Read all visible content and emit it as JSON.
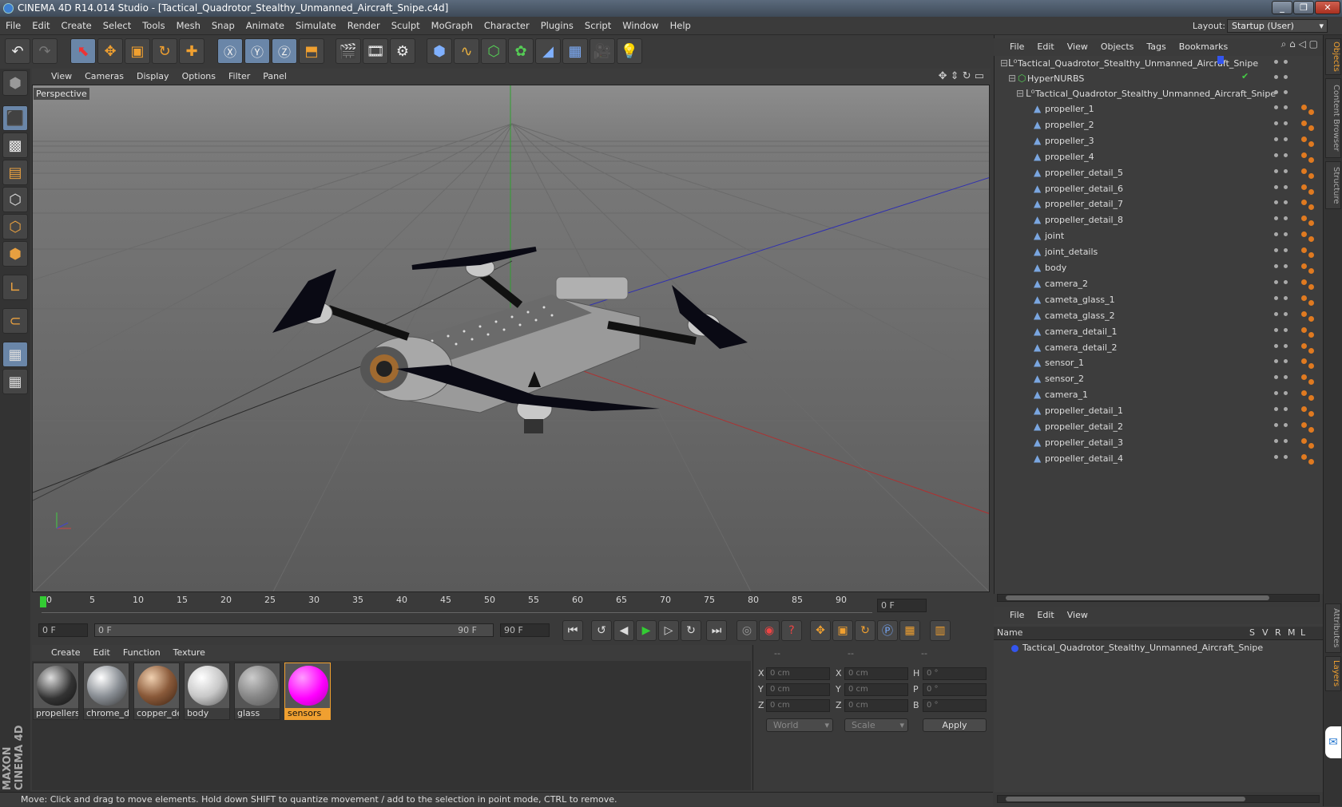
{
  "window": {
    "title": "CINEMA 4D R14.014 Studio - [Tactical_Quadrotor_Stealthy_Unmanned_Aircraft_Snipe.c4d]"
  },
  "menubar": {
    "items": [
      "File",
      "Edit",
      "Create",
      "Select",
      "Tools",
      "Mesh",
      "Snap",
      "Animate",
      "Simulate",
      "Render",
      "Sculpt",
      "MoGraph",
      "Character",
      "Plugins",
      "Script",
      "Window",
      "Help"
    ],
    "layout_label": "Layout:",
    "layout_value": "Startup (User)"
  },
  "viewport": {
    "menu": [
      "View",
      "Cameras",
      "Display",
      "Options",
      "Filter",
      "Panel"
    ],
    "label": "Perspective"
  },
  "timeline": {
    "ticks": [
      "0",
      "5",
      "10",
      "15",
      "20",
      "25",
      "30",
      "35",
      "40",
      "45",
      "50",
      "55",
      "60",
      "65",
      "70",
      "75",
      "80",
      "85",
      "90"
    ],
    "current_frame": "0 F",
    "start_field": "0 F",
    "range_start": "0 F",
    "range_end": "90 F",
    "end_field": "90 F"
  },
  "materials": {
    "menu": [
      "Create",
      "Edit",
      "Function",
      "Texture"
    ],
    "items": [
      {
        "name": "propellers",
        "color": "#3a3a3a"
      },
      {
        "name": "chrome_de",
        "color": "#9aa0a6"
      },
      {
        "name": "copper_det",
        "color": "#8a5a3a"
      },
      {
        "name": "body",
        "color": "#c8c8c8"
      },
      {
        "name": "glass",
        "color": "#888888"
      },
      {
        "name": "sensors",
        "color": "#ff00ff"
      }
    ]
  },
  "coordinates": {
    "headers": [
      "--",
      "--",
      "--"
    ],
    "rows": [
      {
        "axis": "X",
        "pos": "0 cm",
        "axis2": "X",
        "size": "0 cm",
        "axis3": "H",
        "rot": "0 °"
      },
      {
        "axis": "Y",
        "pos": "0 cm",
        "axis2": "Y",
        "size": "0 cm",
        "axis3": "P",
        "rot": "0 °"
      },
      {
        "axis": "Z",
        "pos": "0 cm",
        "axis2": "Z",
        "size": "0 cm",
        "axis3": "B",
        "rot": "0 °"
      }
    ],
    "world": "World",
    "scale": "Scale",
    "apply": "Apply"
  },
  "status": {
    "text": "Move: Click and drag to move elements. Hold down SHIFT to quantize movement / add to the selection in point mode, CTRL to remove."
  },
  "objects": {
    "menu": [
      "File",
      "Edit",
      "View",
      "Objects",
      "Tags",
      "Bookmarks"
    ],
    "root": "Tactical_Quadrotor_Stealthy_Unmanned_Aircraft_Snipe",
    "hypernurbs": "HyperNURBS",
    "group": "Tactical_Quadrotor_Stealthy_Unmanned_Aircraft_Snipe",
    "children": [
      "propeller_1",
      "propeller_2",
      "propeller_3",
      "propeller_4",
      "propeller_detail_5",
      "propeller_detail_6",
      "propeller_detail_7",
      "propeller_detail_8",
      "joint",
      "joint_details",
      "body",
      "camera_2",
      "cameta_glass_1",
      "cameta_glass_2",
      "camera_detail_1",
      "camera_detail_2",
      "sensor_1",
      "sensor_2",
      "camera_1",
      "propeller_detail_1",
      "propeller_detail_2",
      "propeller_detail_3",
      "propeller_detail_4"
    ]
  },
  "layers": {
    "menu": [
      "File",
      "Edit",
      "View"
    ],
    "col_name": "Name",
    "cols": [
      "S",
      "V",
      "R",
      "M",
      "L"
    ],
    "item": "Tactical_Quadrotor_Stealthy_Unmanned_Aircraft_Snipe"
  },
  "side_tabs": [
    "Objects",
    "Content Browser",
    "Structure",
    "Attributes",
    "Layers"
  ]
}
